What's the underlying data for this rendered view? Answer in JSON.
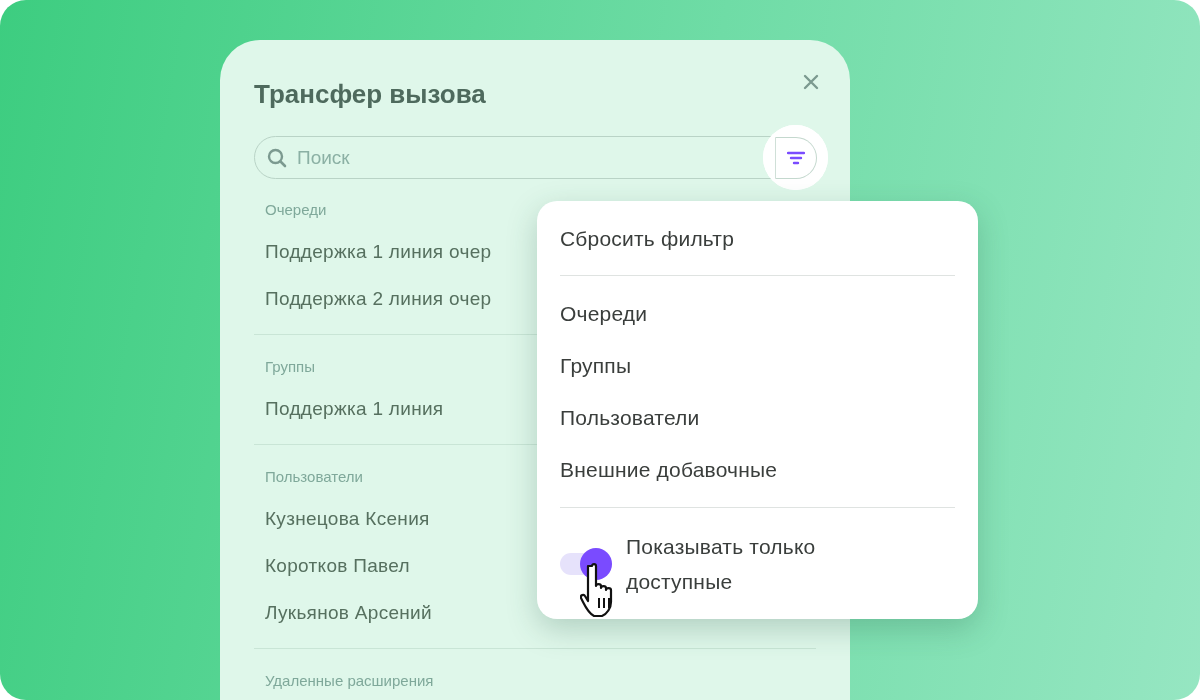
{
  "dialog": {
    "title": "Трансфер вызова",
    "search": {
      "placeholder": "Поиск"
    },
    "sections": [
      {
        "heading": "Очереди",
        "items": [
          "Поддержка 1 линия очер",
          "Поддержка 2 линия очер"
        ]
      },
      {
        "heading": "Группы",
        "items": [
          "Поддержка 1 линия"
        ]
      },
      {
        "heading": "Пользователи",
        "items": [
          "Кузнецова Ксения",
          "Коротков Павел",
          "Лукьянов Арсений"
        ]
      },
      {
        "heading": "Удаленные расширения"
      }
    ]
  },
  "filter_menu": {
    "reset": "Сбросить фильтр",
    "options": [
      "Очереди",
      "Группы",
      "Пользователи",
      "Внешние добавочные"
    ],
    "toggle": {
      "label": "Показывать только доступные",
      "on": true
    }
  }
}
